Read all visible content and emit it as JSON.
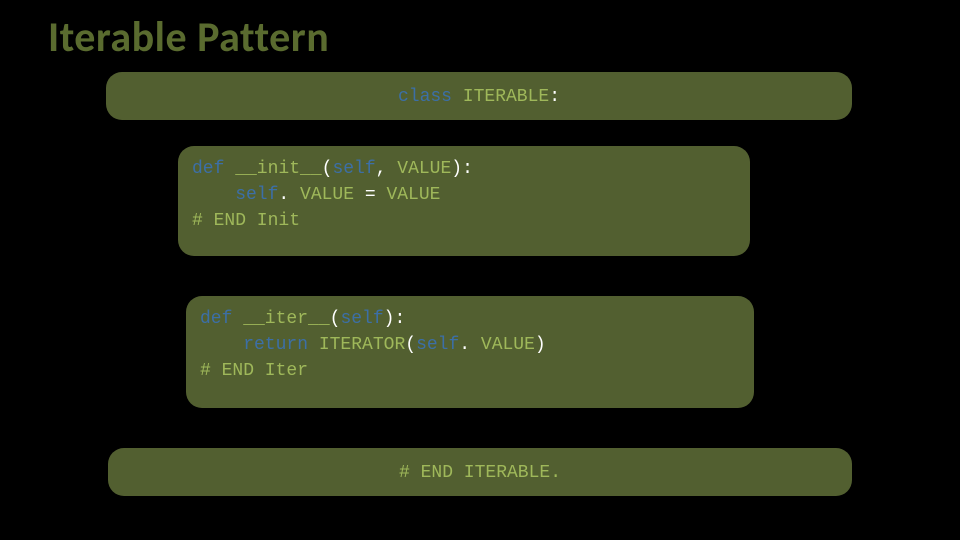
{
  "title": "Iterable Pattern",
  "classBox": {
    "keyword": "class",
    "name": "ITERABLE",
    "colon": ":"
  },
  "initBox": {
    "l1_def": "def",
    "l1_name": " __init__",
    "l1_open": "(",
    "l1_self": "self",
    "l1_comma": ", ",
    "l1_param": "VALUE",
    "l1_close": "):",
    "l2_self": "    self",
    "l2_dot": ". ",
    "l2_lhs": "VALUE",
    "l2_eq": " = ",
    "l2_rhs": "VALUE",
    "l3": "# END Init"
  },
  "iterBox": {
    "l1_def": "def",
    "l1_name": " __iter__",
    "l1_open": "(",
    "l1_self": "self",
    "l1_close": "):",
    "l2_ret": "    return",
    "l2_fn": " ITERATOR",
    "l2_open": "(",
    "l2_self": "self",
    "l2_dot": ". ",
    "l2_val": "VALUE",
    "l2_close": ")",
    "l3": "# END Iter"
  },
  "endBox": {
    "text": "# END ITERABLE."
  }
}
